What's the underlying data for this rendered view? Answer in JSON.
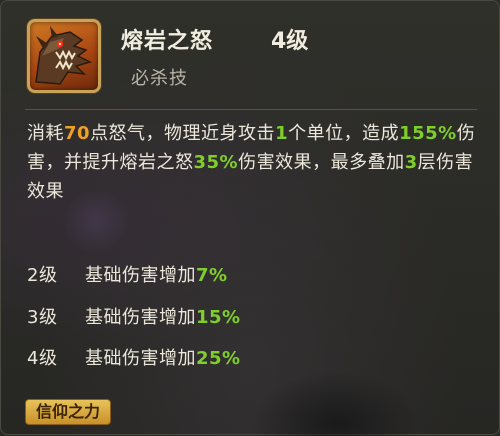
{
  "skill": {
    "name": "熔岩之怒",
    "level": "4级",
    "type": "必杀技",
    "icon": "lava-dragon-icon"
  },
  "description": {
    "p1": "消耗",
    "v1": "70",
    "p2": "点怒气，物理近身攻击",
    "v2": "1",
    "p3": "个单位，造成",
    "v3": "155%",
    "p4": "伤害，并提升熔岩之怒",
    "v4": "35%",
    "p5": "伤害效果，最多叠加",
    "v5": "3",
    "p6": "层伤害效果"
  },
  "upgrades": [
    {
      "level": "2级",
      "text": "基础伤害增加",
      "value": "7%"
    },
    {
      "level": "3级",
      "text": "基础伤害增加",
      "value": "15%"
    },
    {
      "level": "4级",
      "text": "基础伤害增加",
      "value": "25%"
    }
  ],
  "tag": {
    "label": "信仰之力"
  },
  "colors": {
    "value_green": "#7fcf2c",
    "value_orange": "#f0a025",
    "tag_gold": "#e9c25a"
  }
}
